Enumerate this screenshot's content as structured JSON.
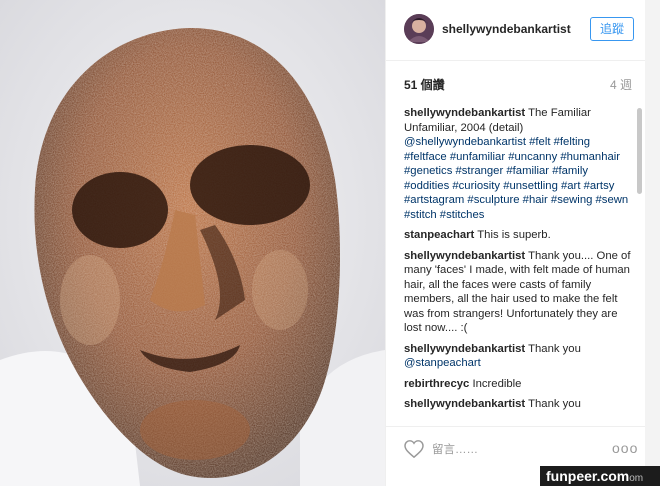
{
  "post": {
    "author": "shellywyndebankartist",
    "follow_label": "追蹤",
    "likes": "51 個讚",
    "age": "4 週"
  },
  "comments": [
    {
      "user": "shellywyndebankartist",
      "text": "The Familiar Unfamiliar, 2004 (detail)",
      "mention": "@shellywyndebankartist",
      "tags": "#felt #felting #feltface #unfamiliar #uncanny #humanhair #genetics #stranger #familiar #family #oddities #curiosity #unsettling #art #artsy #artstagram #sculpture #hair #sewing #sewn #stitch #stitches"
    },
    {
      "user": "stanpeachart",
      "text": "This is superb."
    },
    {
      "user": "shellywyndebankartist",
      "text": "Thank you.... One of many 'faces' I made, with felt made of human hair, all the faces were casts of family members, all the hair used to make the felt was from strangers! Unfortunately they are lost now.... :("
    },
    {
      "user": "shellywyndebankartist",
      "text": "Thank you",
      "mention": "@stanpeachart"
    },
    {
      "user": "rebirthrecyc",
      "text": "Incredible"
    },
    {
      "user": "shellywyndebankartist",
      "text": "Thank you"
    }
  ],
  "footer": {
    "comment_placeholder": "留言……",
    "more_label": "ooo"
  },
  "watermark": {
    "text": "funpeer.com",
    "tail": "om"
  },
  "icons": {
    "like": "heart-icon",
    "more": "more-options-icon"
  },
  "colors": {
    "link": "#003569",
    "accent": "#3897f0"
  }
}
